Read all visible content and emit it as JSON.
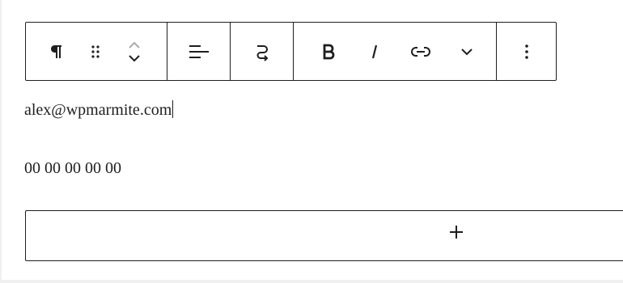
{
  "toolbar": {
    "groups": [
      {
        "items": [
          "pilcrow-icon",
          "drag-handle-icon",
          "move-up-down-icon"
        ]
      },
      {
        "items": [
          "align-left-icon"
        ]
      },
      {
        "items": [
          "transform-icon"
        ]
      },
      {
        "items": [
          "bold-icon",
          "italic-icon",
          "link-icon",
          "chevron-down-icon"
        ]
      },
      {
        "items": [
          "more-options-icon"
        ]
      }
    ]
  },
  "content": {
    "email": "alex@wpmarmite.com",
    "phone": "00 00 00 00 00"
  },
  "appender": {
    "icon": "plus-icon"
  },
  "colors": {
    "border": "#1e1e1e",
    "text": "#1e1e1e",
    "background": "#ffffff"
  }
}
